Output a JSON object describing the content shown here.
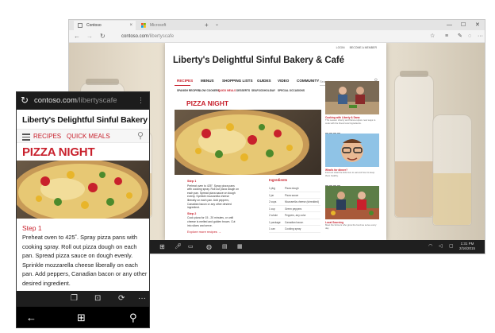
{
  "desktop": {
    "tabs": [
      {
        "label": "Contoso",
        "active": true
      },
      {
        "label": "Microsoft",
        "active": false
      }
    ],
    "new_tab": "+",
    "tab_menu": "⌄",
    "window": {
      "minimize": "—",
      "maximize": "☐",
      "close": "✕"
    },
    "address": {
      "domain": "contoso.com",
      "path": "/libertyscafe"
    },
    "page": {
      "toplinks": [
        "LOGIN",
        "BECOME A MEMBER"
      ],
      "site_title": "Liberty's Delightful Sinful Bakery & Café",
      "nav": [
        "RECIPES",
        "MENUS",
        "SHOPPING LISTS",
        "GUIDES",
        "VIDEO",
        "COMMUNITY"
      ],
      "search_placeholder": "Search",
      "subnav": [
        "SPANISH RECIPES",
        "SLOW COOKERS",
        "QUICK MEALS",
        "DESSERTS",
        "SEAFOOD",
        "HOLIDAY",
        "SPECIAL OCCASIONS"
      ],
      "heading": "PIZZA NIGHT",
      "step1_title": "Step 1",
      "step1_text": "Preheat oven to 425°. Spray pizza pans with cooking spray. Roll out pizza dough on each pan. Spread pizza sauce on dough evenly. Sprinkle mozzarella cheese liberally on each pan. Add peppers, Canadian bacon or any other desired ingredient.",
      "step2_title": "Step 2",
      "step2_text": "Cook pizza for 15 - 20 minutes, or until cheese is melted and golden brown. Cut into slices and serve.",
      "explore": "Explore more recipes →",
      "ingredients_title": "Ingredients",
      "ingredients": [
        {
          "qty": "1 pkg",
          "name": "Pizza dough"
        },
        {
          "qty": "1 jar",
          "name": "Pizza sauce"
        },
        {
          "qty": "2 cups",
          "name": "Mozzarella cheese (shredded)"
        },
        {
          "qty": "1 cup",
          "name": "Green peppers"
        },
        {
          "qty": "2 whole",
          "name": "Peppers, any color"
        },
        {
          "qty": "1 package",
          "name": "Canadian bacon"
        },
        {
          "qty": "1 can",
          "name": "Cooking spray"
        }
      ],
      "sidebar": [
        {
          "caption": "Cooking with Liberty & Dana",
          "text": "This season Liberty and Dana explore new ways to cook with the finest local ingredients."
        },
        {
          "caption": "What's for dinner?",
          "text": "Find out what the kids love to eat and how to keep them healthy."
        },
        {
          "caption": "Local Sourcing",
          "text": "Meet the farmers who grow the food we serve every day."
        }
      ]
    },
    "taskbar": {
      "time": "1:31 PM",
      "date": "2/16/2015"
    }
  },
  "phone": {
    "address": {
      "domain": "contoso.com",
      "path": "/libertyscafe"
    },
    "site_title": "Liberty's Delightful Sinful Bakery & Café",
    "nav": [
      "RECIPES",
      "QUICK MEALS"
    ],
    "heading": "PIZZA NIGHT",
    "step_title": "Step 1",
    "step_text": "Preheat oven to 425˚. Spray pizza pans with cooking spray. Roll out pizza dough on each pan. Spread pizza sauce on dough evenly. Sprinkle mozzarella cheese liberally on each pan. Add peppers, Canadian bacon or any other desired ingredient.",
    "more": "···"
  },
  "colors": {
    "accent": "#c8202c",
    "taskbar": "#1f1f1f",
    "chrome": "#f3f3f3"
  }
}
